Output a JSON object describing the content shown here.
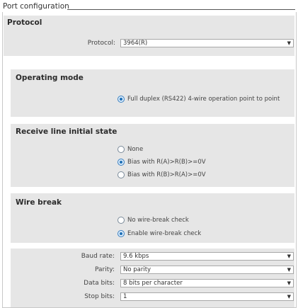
{
  "title": "Port configuration",
  "protocol_section": {
    "heading": "Protocol",
    "protocol_label": "Protocol:",
    "protocol_value": "3964(R)"
  },
  "operating_mode": {
    "heading": "Operating mode",
    "options": [
      {
        "label": "Full duplex (RS422) 4-wire operation point to point",
        "selected": true
      }
    ]
  },
  "receive_line": {
    "heading": "Receive line initial state",
    "options": [
      {
        "label": "None",
        "selected": false
      },
      {
        "label": "Bias with R(A)>R(B)>=0V",
        "selected": true
      },
      {
        "label": "Bias with R(B)>R(A)>=0V",
        "selected": false
      }
    ]
  },
  "wire_break": {
    "heading": "Wire break",
    "options": [
      {
        "label": "No wire-break check",
        "selected": false
      },
      {
        "label": "Enable wire-break check",
        "selected": true
      }
    ]
  },
  "settings": {
    "baud_label": "Baud rate:",
    "baud_value": "9.6 kbps",
    "parity_label": "Parity:",
    "parity_value": "No parity",
    "data_bits_label": "Data bits:",
    "data_bits_value": "8 bits per character",
    "stop_bits_label": "Stop bits:",
    "stop_bits_value": "1"
  }
}
